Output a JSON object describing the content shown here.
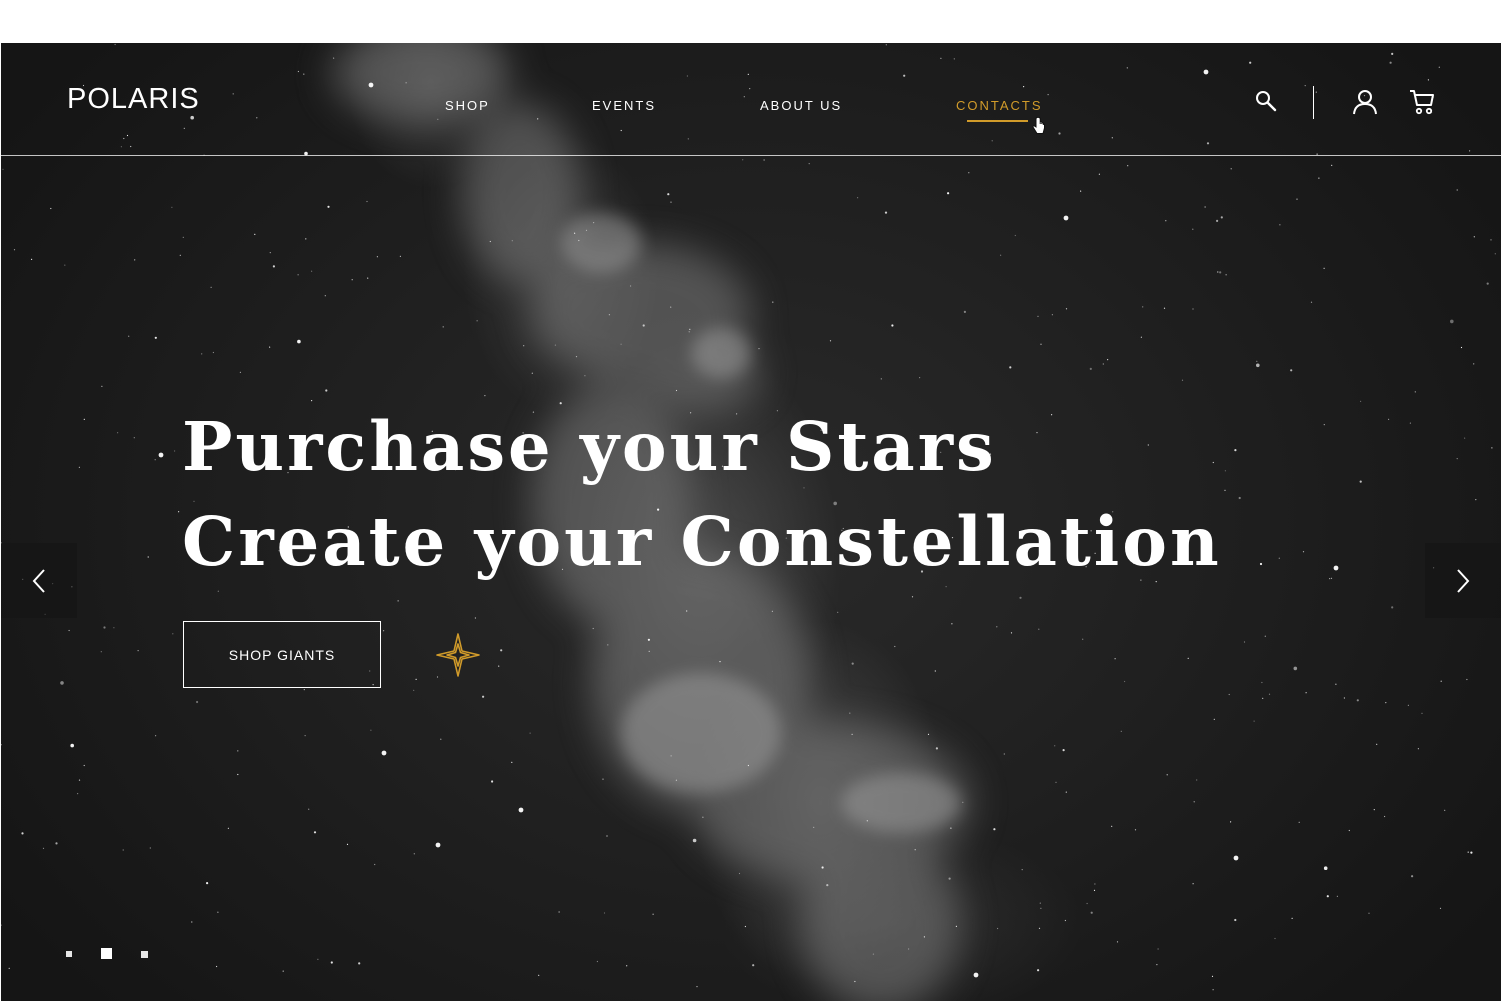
{
  "brand": {
    "logo_text": "POLARIS"
  },
  "nav": {
    "items": [
      {
        "label": "SHOP"
      },
      {
        "label": "EVENTS"
      },
      {
        "label": "ABOUT US"
      },
      {
        "label": "CONTACTS",
        "active": true
      }
    ]
  },
  "header_icons": {
    "search": "search-icon",
    "user": "user-icon",
    "cart": "cart-icon"
  },
  "hero": {
    "headline_line1": "Purchase your Stars",
    "headline_line2": "Create your Constellation",
    "cta_label": "SHOP GIANTS",
    "ornament": "compass-star-icon"
  },
  "carousel": {
    "prev": "chevron-left-icon",
    "next": "chevron-right-icon",
    "slide_count": 3,
    "active_slide": 2
  },
  "colors": {
    "accent": "#d19b2a",
    "background": "#1d1d1d",
    "text": "#ffffff"
  }
}
